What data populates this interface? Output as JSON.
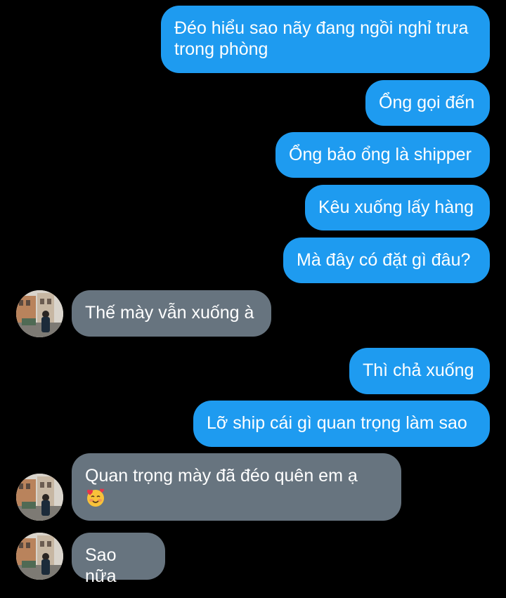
{
  "conversation": {
    "messages": [
      {
        "direction": "outgoing",
        "text": "Đéo hiểu sao nãy đang ngồi nghỉ trưa trong phòng"
      },
      {
        "direction": "outgoing",
        "text": "Ổng gọi đến"
      },
      {
        "direction": "outgoing",
        "text": "Ổng bảo ổng là shipper"
      },
      {
        "direction": "outgoing",
        "text": "Kêu xuống lấy hàng"
      },
      {
        "direction": "outgoing",
        "text": "Mà đây có đặt gì đâu?"
      },
      {
        "direction": "incoming",
        "text": "Thế mày vẫn xuống à"
      },
      {
        "direction": "outgoing",
        "text": "Thì chả xuống"
      },
      {
        "direction": "outgoing",
        "text": "Lỡ ship cái gì quan trọng làm sao"
      },
      {
        "direction": "incoming",
        "text": "Quan trọng mày đã đéo quên em ạ",
        "emoji": "smiling-face-with-hearts"
      },
      {
        "direction": "incoming",
        "text": "Sao nữa"
      }
    ]
  },
  "colors": {
    "background": "#000000",
    "outgoing_bubble": "#1e9bf0",
    "incoming_bubble": "#67747f",
    "text": "#ffffff"
  }
}
